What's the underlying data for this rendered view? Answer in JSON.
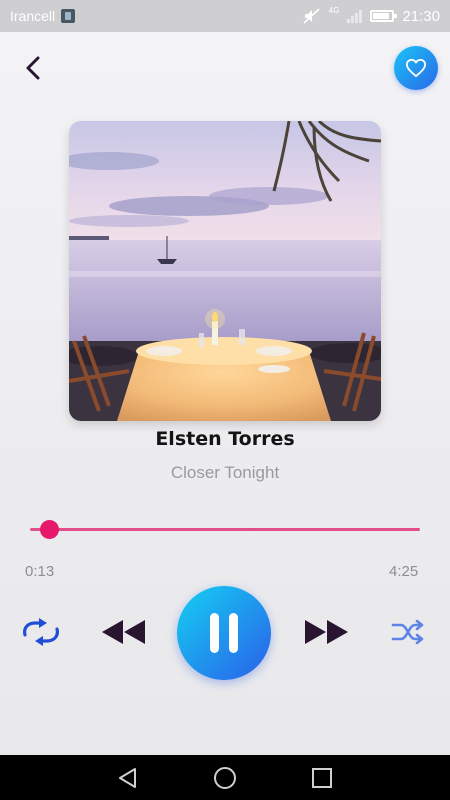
{
  "status_bar": {
    "carrier": "Irancell",
    "network": "4G",
    "time": "21:30",
    "icons": [
      "sim-icon",
      "mute-icon",
      "signal-icon",
      "battery-icon"
    ]
  },
  "header": {
    "back_icon": "chevron-left-icon",
    "favorite_icon": "heart-icon",
    "accent_color": "#2b6cea"
  },
  "track": {
    "title": "Elsten Torres",
    "subtitle": "Closer Tonight",
    "artwork_icon": "album-art-sunset-dinner"
  },
  "progress": {
    "elapsed": "0:13",
    "total": "4:25",
    "fraction": 0.05,
    "color": "#e5186c"
  },
  "controls": {
    "repeat_icon": "repeat-icon",
    "previous_icon": "rewind-icon",
    "play_pause_icon": "pause-icon",
    "next_icon": "fast-forward-icon",
    "shuffle_icon": "shuffle-icon",
    "play_gradient": [
      "#14d0f2",
      "#2b5fe9"
    ]
  },
  "nav_bar": {
    "icons": [
      "back-triangle-icon",
      "home-circle-icon",
      "recents-square-icon"
    ]
  }
}
